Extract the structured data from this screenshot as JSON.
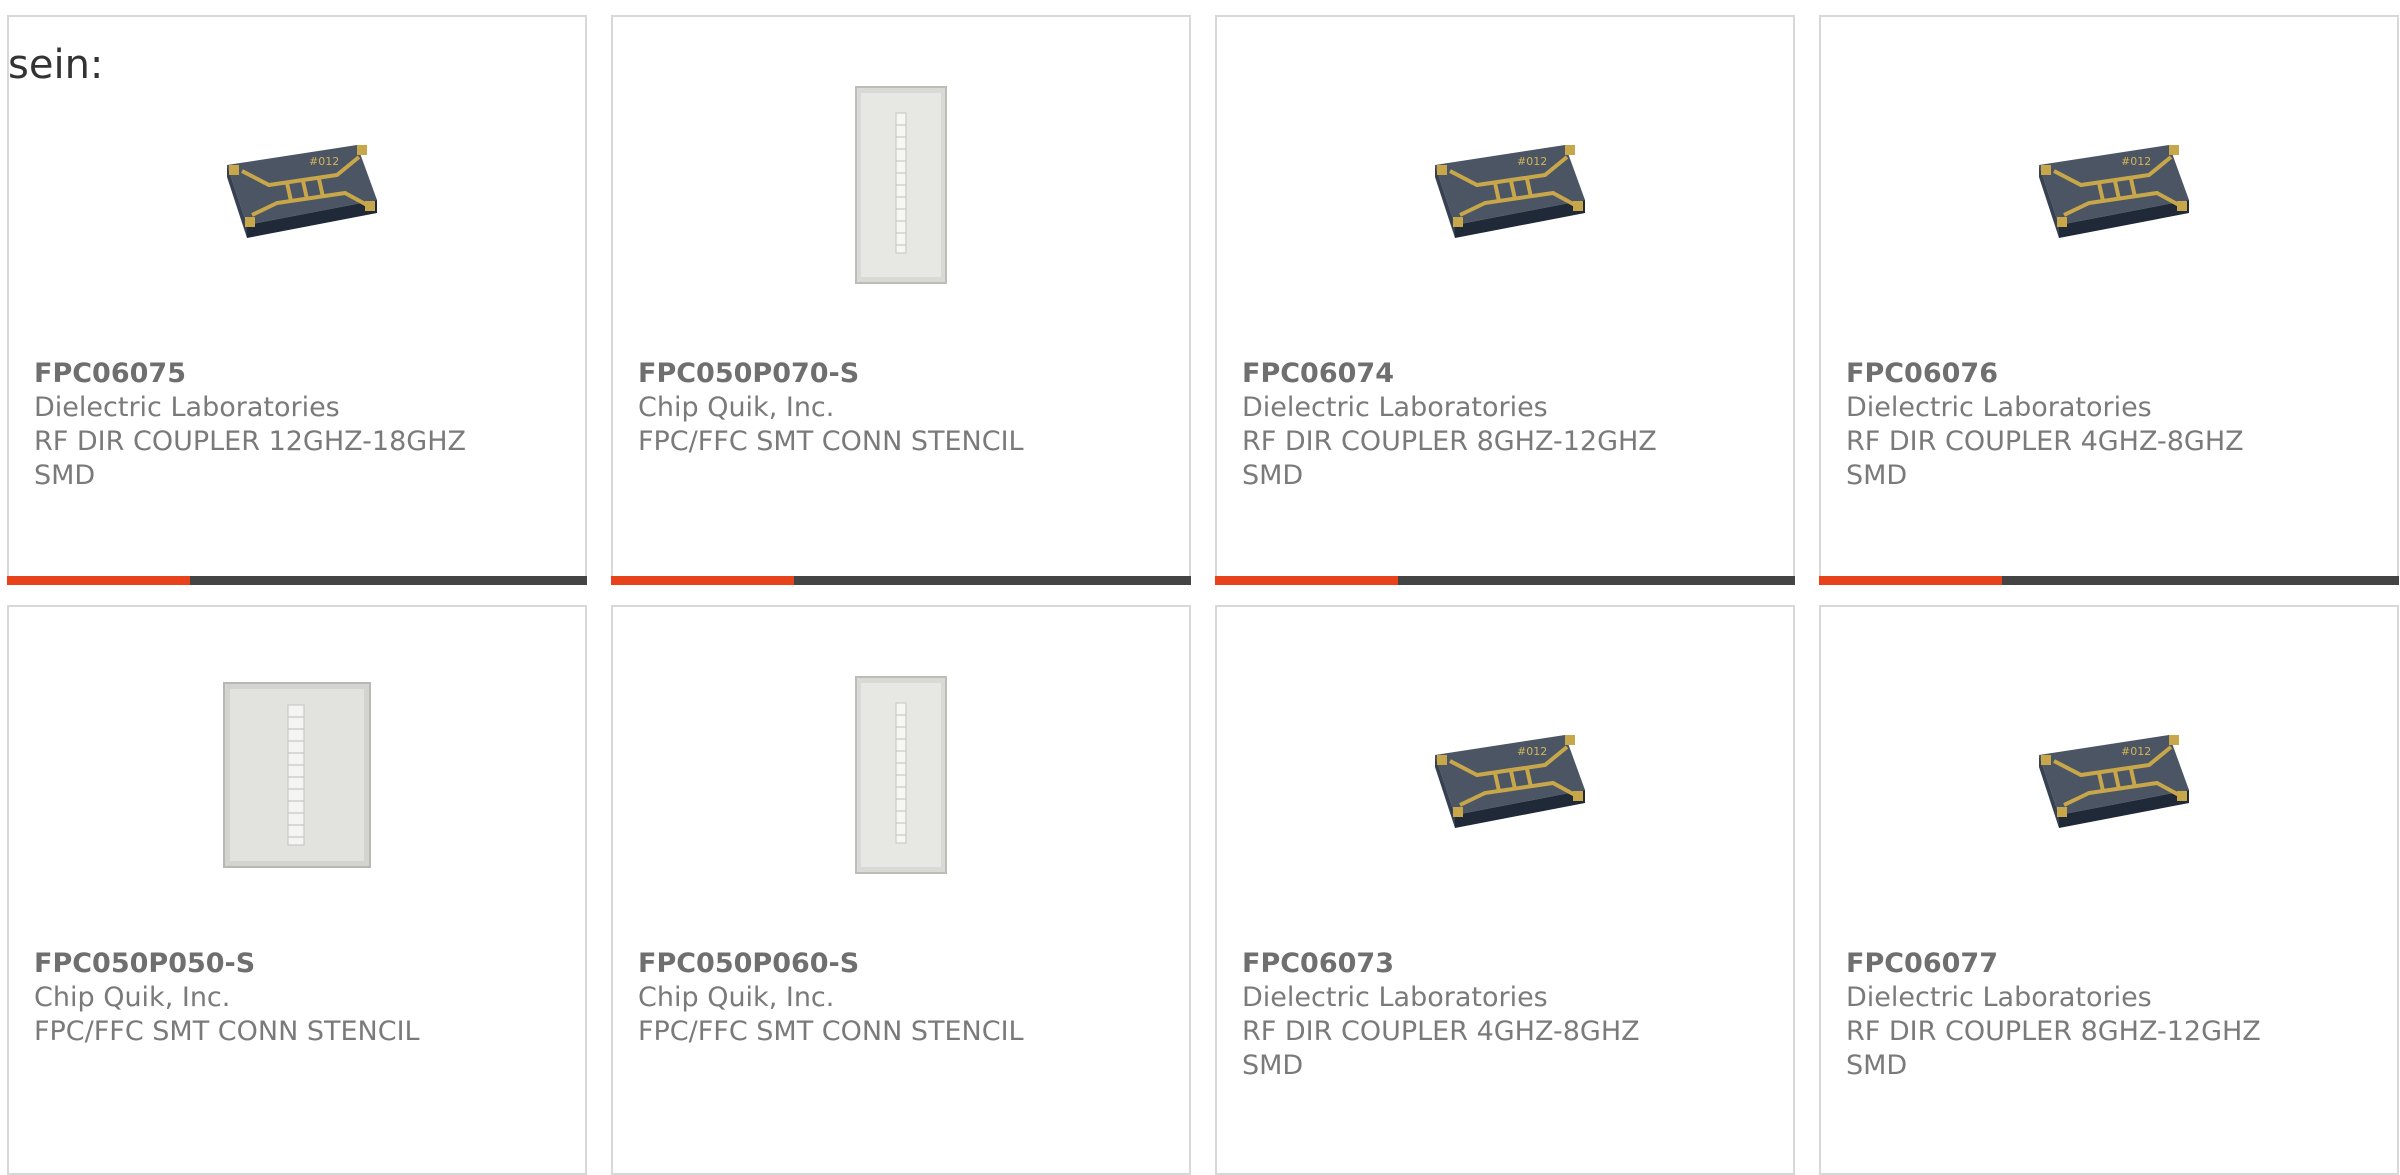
{
  "lead_text": "sein:",
  "colors": {
    "accent": "#e8421a",
    "bar_base": "#444444",
    "card_border": "#d8d8d8",
    "text": "#7a7a7a"
  },
  "products": [
    {
      "part": "FPC06075",
      "maker": "Dielectric Laboratories",
      "desc1": "RF DIR COUPLER 12GHZ-18GHZ",
      "desc2": "SMD",
      "image": "rf-coupler-chip",
      "bar": true
    },
    {
      "part": "FPC050P070-S",
      "maker": "Chip Quik, Inc.",
      "desc1": "FPC/FFC SMT CONN STENCIL",
      "desc2": "",
      "image": "stencil-narrow",
      "bar": true
    },
    {
      "part": "FPC06074",
      "maker": "Dielectric Laboratories",
      "desc1": "RF DIR COUPLER 8GHZ-12GHZ",
      "desc2": "SMD",
      "image": "rf-coupler-chip",
      "bar": true
    },
    {
      "part": "FPC06076",
      "maker": "Dielectric Laboratories",
      "desc1": "RF DIR COUPLER 4GHZ-8GHZ",
      "desc2": "SMD",
      "image": "rf-coupler-chip",
      "bar": true
    },
    {
      "part": "FPC050P050-S",
      "maker": "Chip Quik, Inc.",
      "desc1": "FPC/FFC SMT CONN STENCIL",
      "desc2": "",
      "image": "stencil-wide",
      "bar": false
    },
    {
      "part": "FPC050P060-S",
      "maker": "Chip Quik, Inc.",
      "desc1": "FPC/FFC SMT CONN STENCIL",
      "desc2": "",
      "image": "stencil-narrow",
      "bar": false
    },
    {
      "part": "FPC06073",
      "maker": "Dielectric Laboratories",
      "desc1": "RF DIR COUPLER 4GHZ-8GHZ",
      "desc2": "SMD",
      "image": "rf-coupler-chip",
      "bar": false
    },
    {
      "part": "FPC06077",
      "maker": "Dielectric Laboratories",
      "desc1": "RF DIR COUPLER 8GHZ-12GHZ",
      "desc2": "SMD",
      "image": "rf-coupler-chip",
      "bar": false
    }
  ]
}
